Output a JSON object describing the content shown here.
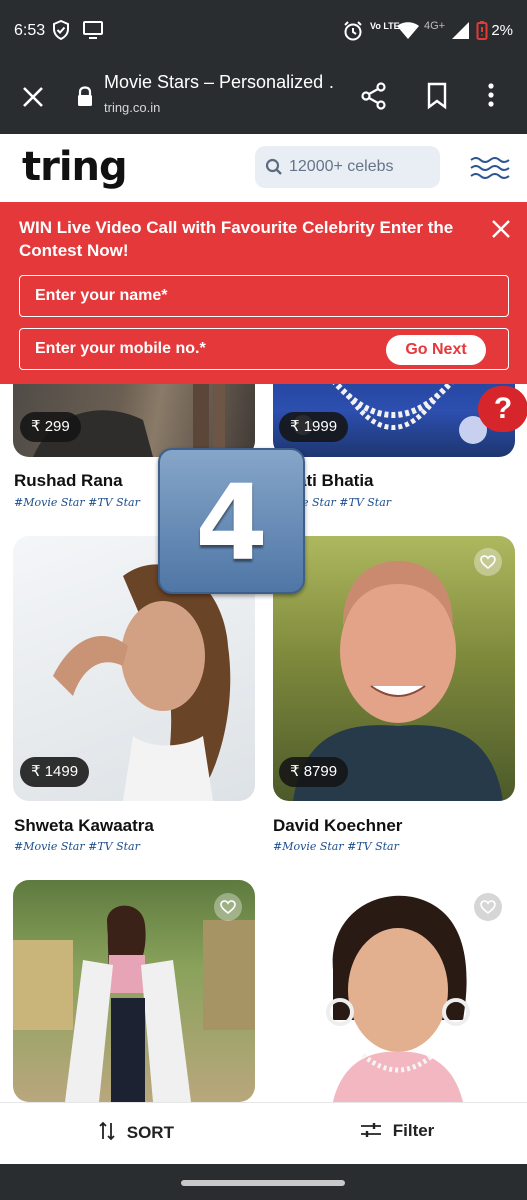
{
  "status_bar": {
    "time": "6:53",
    "battery": "2%",
    "network": "4G+",
    "volte": "Vo LTE"
  },
  "browser": {
    "title": "Movie Stars – Personalized …",
    "url": "tring.co.in"
  },
  "site": {
    "logo": "tring",
    "search_placeholder": "12000+ celebs"
  },
  "promo": {
    "text": "WIN Live Video Call with Favourite Celebrity Enter the Contest Now!",
    "name_placeholder": "Enter your name*",
    "mobile_placeholder": "Enter your mobile no.*",
    "go_next": "Go Next"
  },
  "help_label": "?",
  "overlay_number": "4",
  "cards": [
    {
      "name": "Rushad Rana",
      "price": "₹ 299",
      "tags": "#Movie Star #TV Star"
    },
    {
      "name": "ati Bhatia",
      "price": "₹ 1999",
      "tags": "e Star #TV Star"
    },
    {
      "name": "Shweta Kawaatra",
      "price": "₹ 1499",
      "tags": "#Movie Star #TV Star"
    },
    {
      "name": "David Koechner",
      "price": "₹ 8799",
      "tags": "#Movie Star #TV Star"
    },
    {
      "name": "",
      "price": "",
      "tags": ""
    },
    {
      "name": "",
      "price": "",
      "tags": ""
    }
  ],
  "bottom": {
    "sort": "SORT",
    "filter": "Filter"
  }
}
